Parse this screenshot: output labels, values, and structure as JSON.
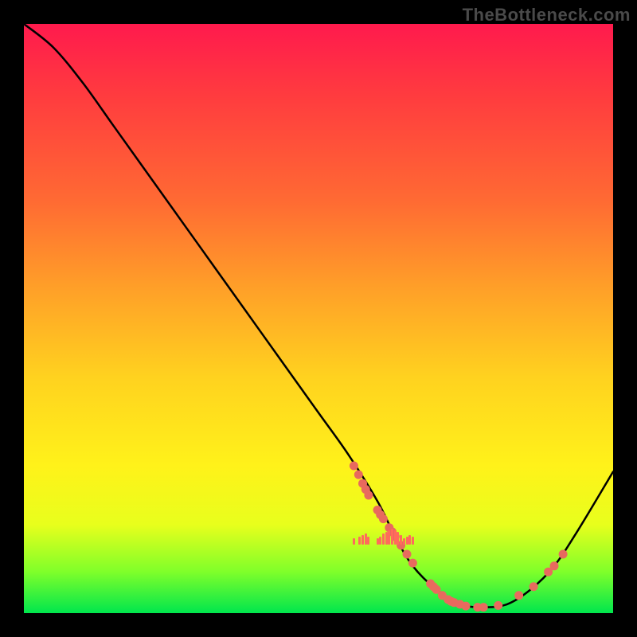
{
  "watermark": "TheBottleneck.com",
  "colors": {
    "background": "#000000",
    "curve": "#000000",
    "points": "#e86a5e",
    "ticks": "#ff6b5c",
    "gradient_stops": [
      "#ff1a4d",
      "#ff3b3f",
      "#ff6a33",
      "#ffa028",
      "#ffd21f",
      "#fff21a",
      "#e8ff1c",
      "#7fff2a",
      "#00e64d"
    ]
  },
  "chart_data": {
    "type": "line",
    "title": "",
    "xlabel": "",
    "ylabel": "",
    "xlim": [
      0,
      100
    ],
    "ylim": [
      0,
      100
    ],
    "curve": {
      "x": [
        0,
        5,
        10,
        15,
        20,
        25,
        30,
        35,
        40,
        45,
        50,
        55,
        60,
        63,
        66,
        70,
        74,
        78,
        82,
        86,
        90,
        94,
        100
      ],
      "y": [
        100,
        96,
        90,
        83,
        76,
        69,
        62,
        55,
        48,
        41,
        34,
        27,
        19,
        13,
        8,
        4,
        1.5,
        1,
        1.5,
        4,
        8,
        14,
        24
      ]
    },
    "points": [
      {
        "x": 56,
        "y": 25
      },
      {
        "x": 56.8,
        "y": 23.5
      },
      {
        "x": 57.5,
        "y": 22
      },
      {
        "x": 58,
        "y": 21
      },
      {
        "x": 58.5,
        "y": 20
      },
      {
        "x": 60,
        "y": 17.5
      },
      {
        "x": 60.5,
        "y": 16.7
      },
      {
        "x": 61,
        "y": 16
      },
      {
        "x": 62,
        "y": 14.5
      },
      {
        "x": 62.5,
        "y": 13.8
      },
      {
        "x": 63,
        "y": 13
      },
      {
        "x": 64,
        "y": 11.5
      },
      {
        "x": 65,
        "y": 10
      },
      {
        "x": 66,
        "y": 8.5
      },
      {
        "x": 69,
        "y": 5
      },
      {
        "x": 69.5,
        "y": 4.5
      },
      {
        "x": 70,
        "y": 4
      },
      {
        "x": 71,
        "y": 3
      },
      {
        "x": 72,
        "y": 2.3
      },
      {
        "x": 72.5,
        "y": 2
      },
      {
        "x": 73,
        "y": 1.8
      },
      {
        "x": 74,
        "y": 1.5
      },
      {
        "x": 75,
        "y": 1.2
      },
      {
        "x": 77,
        "y": 1
      },
      {
        "x": 78,
        "y": 1
      },
      {
        "x": 80.5,
        "y": 1.3
      },
      {
        "x": 84,
        "y": 3
      },
      {
        "x": 86.5,
        "y": 4.5
      },
      {
        "x": 89,
        "y": 7
      },
      {
        "x": 90,
        "y": 8
      },
      {
        "x": 91.5,
        "y": 10
      }
    ],
    "tick_clusters": [
      {
        "x": 56,
        "h": 8
      },
      {
        "x": 57,
        "h": 10
      },
      {
        "x": 57.5,
        "h": 12
      },
      {
        "x": 58,
        "h": 14
      },
      {
        "x": 58.5,
        "h": 10
      },
      {
        "x": 60,
        "h": 8
      },
      {
        "x": 60.5,
        "h": 10
      },
      {
        "x": 61,
        "h": 14
      },
      {
        "x": 61.5,
        "h": 16
      },
      {
        "x": 62,
        "h": 18
      },
      {
        "x": 62.5,
        "h": 20
      },
      {
        "x": 63,
        "h": 18
      },
      {
        "x": 63.5,
        "h": 16
      },
      {
        "x": 64,
        "h": 12
      },
      {
        "x": 64.5,
        "h": 8
      },
      {
        "x": 65,
        "h": 10
      },
      {
        "x": 65.5,
        "h": 12
      },
      {
        "x": 66,
        "h": 10
      }
    ]
  }
}
